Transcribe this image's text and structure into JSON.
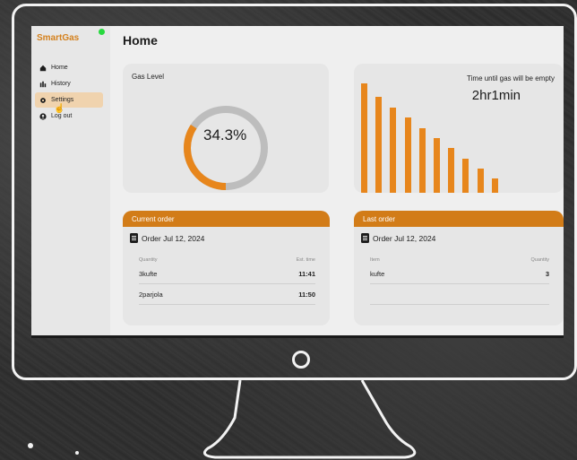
{
  "app": {
    "brand": "SmartGas",
    "accent_color": "#d4801c",
    "status_led_color": "#27d93e"
  },
  "sidebar": {
    "items": [
      {
        "label": "Home",
        "icon": "home-icon"
      },
      {
        "label": "History",
        "icon": "history-icon"
      },
      {
        "label": "Settings",
        "icon": "gear-icon",
        "active": true
      },
      {
        "label": "Log out",
        "icon": "user-icon"
      }
    ]
  },
  "main": {
    "title": "Home"
  },
  "gas_level": {
    "label": "Gas Level",
    "display": "34.3%",
    "fraction": 0.343
  },
  "time_until_empty": {
    "label": "Time until gas will be empty",
    "value": "2hr1min",
    "bar_levels": [
      1.0,
      0.88,
      0.78,
      0.69,
      0.59,
      0.5,
      0.41,
      0.31,
      0.22,
      0.13
    ]
  },
  "current_order": {
    "header": "Current order",
    "title": "Order Jul 12, 2024",
    "col_left": "Quantity",
    "col_right": "Est. time",
    "rows": [
      {
        "left": "3kufte",
        "right": "11:41"
      },
      {
        "left": "2parjola",
        "right": "11:50"
      }
    ]
  },
  "last_order": {
    "header": "Last order",
    "title": "Order Jul 12, 2024",
    "col_left": "Item",
    "col_right": "Quantity",
    "rows": [
      {
        "left": "kufte",
        "right": "3"
      }
    ]
  }
}
